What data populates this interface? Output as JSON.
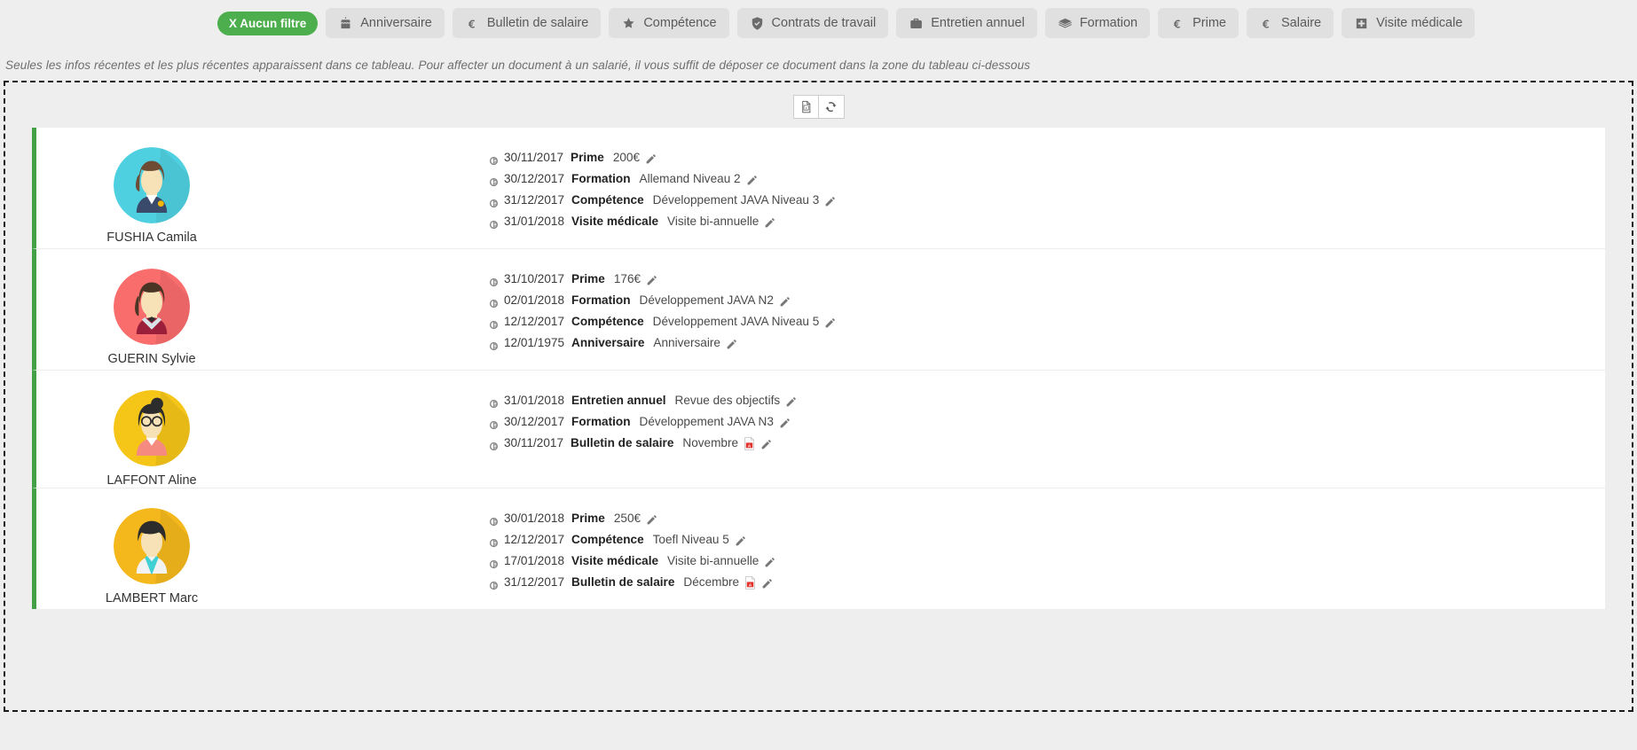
{
  "filters": [
    {
      "label": "X Aucun filtre",
      "icon": "none-filter-icon",
      "active": true
    },
    {
      "label": "Anniversaire",
      "icon": "cake-icon",
      "active": false
    },
    {
      "label": "Bulletin de salaire",
      "icon": "euro-icon",
      "active": false
    },
    {
      "label": "Compétence",
      "icon": "star-icon",
      "active": false
    },
    {
      "label": "Contrats de travail",
      "icon": "shield-check-icon",
      "active": false
    },
    {
      "label": "Entretien annuel",
      "icon": "briefcase-icon",
      "active": false
    },
    {
      "label": "Formation",
      "icon": "graduation-icon",
      "active": false
    },
    {
      "label": "Prime",
      "icon": "euro-icon",
      "active": false
    },
    {
      "label": "Salaire",
      "icon": "euro-icon",
      "active": false
    },
    {
      "label": "Visite médicale",
      "icon": "medical-cross-icon",
      "active": false
    }
  ],
  "hint": "Seules les infos récentes et les plus récentes apparaissent dans ce tableau.  Pour affecter un document à un salarié, il vous suffit de déposer ce document dans la zone du tableau ci-dessous",
  "tools": [
    {
      "name": "export-excel-button",
      "icon": "excel-file-icon",
      "title": "Export Excel"
    },
    {
      "name": "refresh-button",
      "icon": "refresh-icon",
      "title": "Rafraîchir"
    }
  ],
  "colors": {
    "accent_green": "#43a047",
    "chip_active": "#4cae4c",
    "page_bg": "#eeeeee",
    "row_bg": "#ffffff"
  },
  "rows": [
    {
      "name": "FUSHIA Camila",
      "avatar": {
        "bg": "#4fd0e0",
        "hair": "#6d4c33",
        "skin": "#f7e2b8",
        "cloth": "#3a4a6b",
        "accent": "#f2b705"
      },
      "events": [
        {
          "date": "30/11/2017",
          "type": "Prime",
          "value": "200€",
          "pdf": false
        },
        {
          "date": "30/12/2017",
          "type": "Formation",
          "value": "Allemand Niveau 2",
          "pdf": false
        },
        {
          "date": "31/12/2017",
          "type": "Compétence",
          "value": "Développement JAVA Niveau 3",
          "pdf": false
        },
        {
          "date": "31/01/2018",
          "type": "Visite médicale",
          "value": "Visite bi-annuelle",
          "pdf": false
        }
      ]
    },
    {
      "name": "GUERIN Sylvie",
      "avatar": {
        "bg": "#f96d6d",
        "hair": "#4a3423",
        "skin": "#f7e2b8",
        "cloth": "#9b1f3a",
        "accent": "#d7e3e8"
      },
      "events": [
        {
          "date": "31/10/2017",
          "type": "Prime",
          "value": "176€",
          "pdf": false
        },
        {
          "date": "02/01/2018",
          "type": "Formation",
          "value": "Développement JAVA N2",
          "pdf": false
        },
        {
          "date": "12/12/2017",
          "type": "Compétence",
          "value": "Développement JAVA Niveau 5",
          "pdf": false
        },
        {
          "date": "12/01/1975",
          "type": "Anniversaire",
          "value": "Anniversaire",
          "pdf": false
        }
      ]
    },
    {
      "name": "LAFFONT Aline",
      "avatar": {
        "bg": "#f5c518",
        "hair": "#2c2c2c",
        "skin": "#f7e2b8",
        "cloth": "#f58b80",
        "accent": "#ffffff"
      },
      "events": [
        {
          "date": "31/01/2018",
          "type": "Entretien annuel",
          "value": "Revue des objectifs",
          "pdf": false
        },
        {
          "date": "30/12/2017",
          "type": "Formation",
          "value": "Développement JAVA N3",
          "pdf": false
        },
        {
          "date": "30/11/2017",
          "type": "Bulletin de salaire",
          "value": "Novembre",
          "pdf": true
        }
      ]
    },
    {
      "name": "LAMBERT Marc",
      "avatar": {
        "bg": "#f5b81c",
        "hair": "#2c2c2c",
        "skin": "#f7e2b8",
        "cloth": "#f2f2f2",
        "accent": "#3fd0d4"
      },
      "events": [
        {
          "date": "30/01/2018",
          "type": "Prime",
          "value": "250€",
          "pdf": false
        },
        {
          "date": "12/12/2017",
          "type": "Compétence",
          "value": "Toefl Niveau 5",
          "pdf": false
        },
        {
          "date": "17/01/2018",
          "type": "Visite médicale",
          "value": "Visite bi-annuelle",
          "pdf": false
        },
        {
          "date": "31/12/2017",
          "type": "Bulletin de salaire",
          "value": "Décembre",
          "pdf": true
        }
      ]
    }
  ]
}
